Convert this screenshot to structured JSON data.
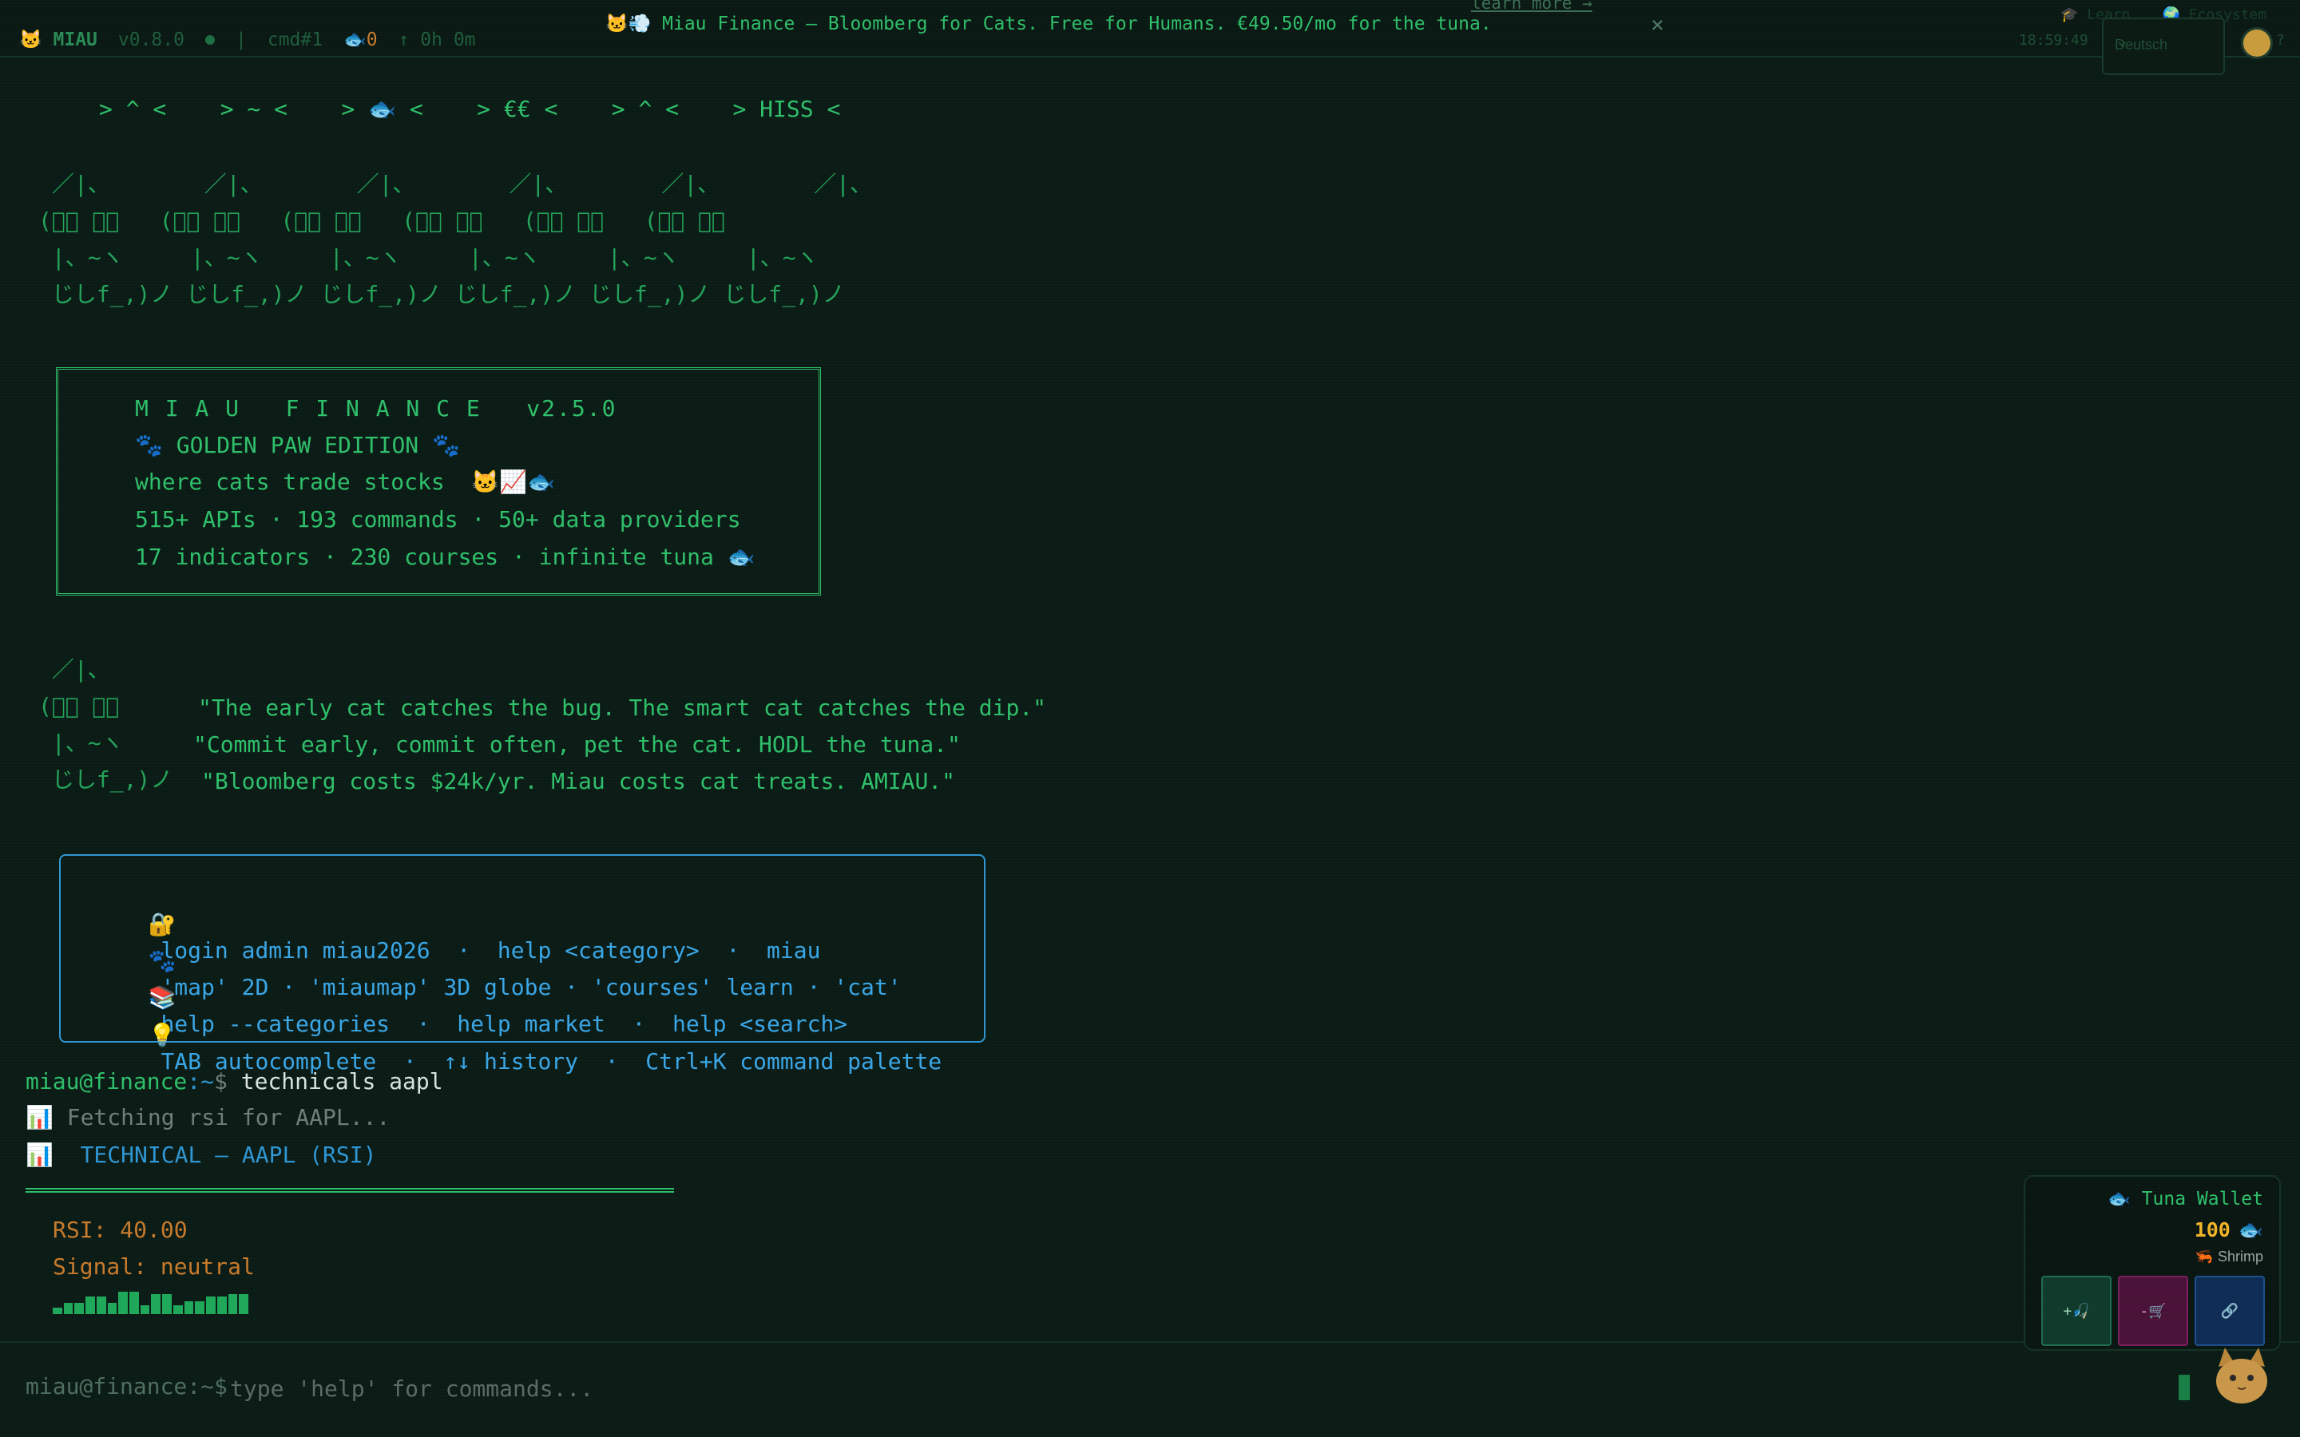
{
  "topbar": {
    "brand": "MIAU",
    "version": "v0.8.0",
    "separator": "|",
    "cmd_count": "cmd#1",
    "fish_count": "0",
    "uptime": "↑ 0h 0m",
    "banner_text": "🐱💨 Miau Finance — Bloomberg for Cats. Free for Humans. €49.50/mo for the tuna.",
    "learn_more": "learn more →",
    "close": "×",
    "link_learn": "🎓 Learn",
    "link_ecosystem": "🌍 Ecosystem",
    "clock": "18:59:49",
    "language": "Deutsch",
    "help": "?"
  },
  "terminal": {
    "emote_row": "> ^ <    > ~ <    > 🐟 <    > €€ <    > ^ <    > HISS <",
    "cat_row": [
      " ／|、       ／|、       ／|、       ／|、       ／|、       ／|、",
      "(ﾟ､ ｡７   (ﾟ､ ｡７   (ﾟ､ ｡７   (ﾟ､ ｡７   (ﾟ､ ｡７   (ﾟ､ ｡７",
      " |、~ヽ     |、~ヽ     |、~ヽ     |、~ヽ     |、~ヽ     |、~ヽ",
      " じしf_,)ノ じしf_,)ノ じしf_,)ノ じしf_,)ノ じしf_,)ノ じしf_,)ノ"
    ],
    "golden_box": {
      "title": "M I A U   F I N A N C E   v2.5.0",
      "edition": "🐾 GOLDEN PAW EDITION 🐾",
      "tagline": "where cats trade stocks  🐱📈🐟",
      "stats1": "515+ APIs · 193 commands · 50+ data providers",
      "stats2": "17 indicators · 230 courses · infinite tuna 🐟"
    },
    "quote_cat": [
      " ／|、",
      "(ﾟ､ ｡７",
      " |、~ヽ",
      " じしf_,)ノ"
    ],
    "quotes": [
      "\"The early cat catches the bug. The smart cat catches the dip.\"",
      "\"Commit early, commit often, pet the cat. HODL the tuna.\"",
      "\"Bloomberg costs $24k/yr. Miau costs cat treats. AMIAU.\""
    ],
    "help_box": [
      {
        "icon": "🔐",
        "text": "login admin miau2026  ·  help <category>  ·  miau"
      },
      {
        "icon": "🐾",
        "text": "'map' 2D · 'miaumap' 3D globe · 'courses' learn · 'cat'"
      },
      {
        "icon": "📚",
        "text": "help --categories  ·  help market  ·  help <search>"
      },
      {
        "icon": "💡",
        "text": "TAB autocomplete  ·  ↑↓ history  ·  Ctrl+K command palette"
      }
    ],
    "prompt_user": "miau@finance",
    "prompt_path": ":~",
    "prompt_symbol": "$",
    "last_command": " technicals aapl",
    "fetching": "📊 Fetching rsi for AAPL...",
    "result_title": "📊  TECHNICAL — AAPL (RSI)",
    "rsi_line": "RSI: 40.00",
    "signal_line": "Signal: neutral",
    "sparkline_values": [
      2,
      4,
      4,
      7,
      7,
      4,
      9,
      9,
      3,
      8,
      8,
      3,
      5,
      5,
      7,
      7,
      8,
      8
    ]
  },
  "input": {
    "prompt": "miau@finance:~$",
    "placeholder": "type 'help' for commands..."
  },
  "wallet": {
    "title": "🐟 Tuna Wallet",
    "amount": "100",
    "fish": "🐟",
    "rank_icon": "🦐",
    "rank": "Shrimp",
    "earn_label": "+🎣",
    "spend_label": "-🛒",
    "link_label": "🔗"
  },
  "colors": {
    "background": "#0b1c16",
    "terminal_green": "#2fbf6a",
    "accent_blue": "#2f96d4",
    "warning_orange": "#c77a2b",
    "tuna_gold": "#f0b429"
  }
}
